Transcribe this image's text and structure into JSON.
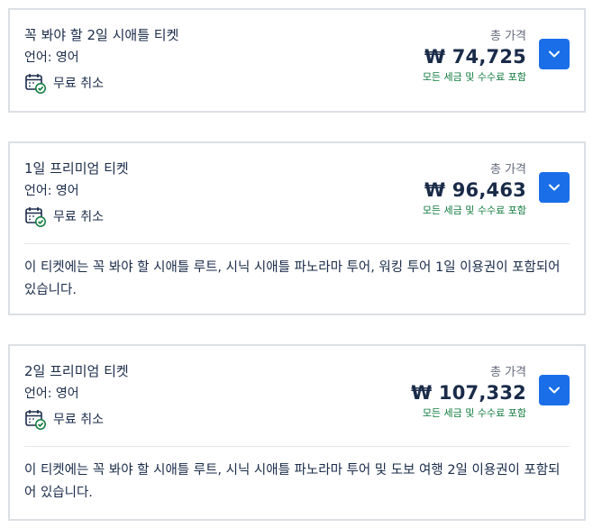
{
  "tickets": [
    {
      "title": "꼭 봐야 할 2일 시애틀 티켓",
      "language": "언어: 영어",
      "cancel_label": "무료 취소",
      "price_label": "총 가격",
      "price": "₩ 74,725",
      "price_note": "모든 세금 및 수수료 포함",
      "description": ""
    },
    {
      "title": "1일 프리미엄 티켓",
      "language": "언어: 영어",
      "cancel_label": "무료 취소",
      "price_label": "총 가격",
      "price": "₩ 96,463",
      "price_note": "모든 세금 및 수수료 포함",
      "description": "이 티켓에는 꼭 봐야 할 시애틀 루트, 시닉 시애틀 파노라마 투어, 워킹 투어 1일 이용권이 포함되어 있습니다."
    },
    {
      "title": "2일 프리미엄 티켓",
      "language": "언어: 영어",
      "cancel_label": "무료 취소",
      "price_label": "총 가격",
      "price": "₩ 107,332",
      "price_note": "모든 세금 및 수수료 포함",
      "description": "이 티켓에는 꼭 봐야 할 시애틀 루트, 시닉 시애틀 파노라마 투어 및 도보 여행 2일 이용권이 포함되어 있습니다."
    }
  ],
  "icons": {
    "cancel": "calendar-check-icon",
    "toggle": "chevron-down-icon"
  },
  "colors": {
    "accent": "#1a6fe8",
    "text": "#1a2b49",
    "note_green": "#0f7a3c",
    "border": "#dcdfe4"
  }
}
